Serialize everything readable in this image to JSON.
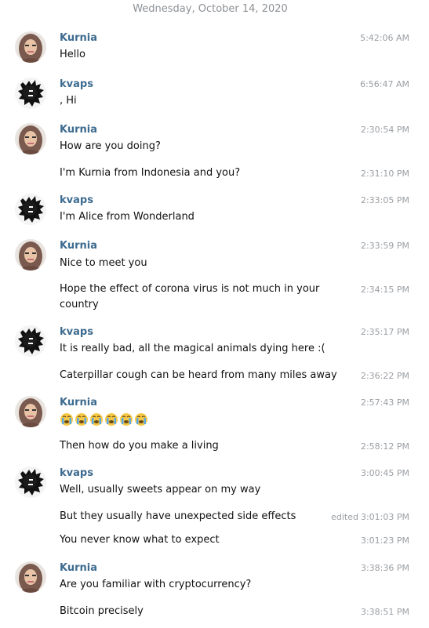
{
  "date_divider": "Wednesday, October 14, 2020",
  "messages": [
    {
      "sender": "Kurnia",
      "text": "Hello",
      "time": "5:42:06 AM"
    },
    {
      "sender": "kvaps",
      "text": ", Hi",
      "time": "6:56:47 AM"
    },
    {
      "sender": "Kurnia",
      "text": "How are you doing?",
      "time": "2:30:54 PM"
    },
    {
      "text": "I'm Kurnia from Indonesia and you?",
      "time": "2:31:10 PM"
    },
    {
      "sender": "kvaps",
      "text": "I'm Alice from Wonderland",
      "time": "2:33:05 PM"
    },
    {
      "sender": "Kurnia",
      "text": "Nice to meet you",
      "time": "2:33:59 PM"
    },
    {
      "text": "Hope the effect of corona virus is not much in your country",
      "time": "2:34:15 PM"
    },
    {
      "sender": "kvaps",
      "text": "It is really bad, all the magical animals dying here :(",
      "time": "2:35:17 PM"
    },
    {
      "text": "Caterpillar cough can be heard from many miles away",
      "time": "2:36:22 PM"
    },
    {
      "sender": "Kurnia",
      "emoji": "loudly-crying-face",
      "emoji_count": 6,
      "time": "2:57:43 PM"
    },
    {
      "text": "Then how do you make a living",
      "time": "2:58:12 PM"
    },
    {
      "sender": "kvaps",
      "text": "Well, usually sweets appear on my way",
      "time": "3:00:45 PM"
    },
    {
      "text": "But they usually have unexpected side effects",
      "edited": "edited",
      "time": "3:01:03 PM"
    },
    {
      "text": "You never know what to expect",
      "time": "3:01:23 PM"
    },
    {
      "sender": "Kurnia",
      "text": "Are you familiar with cryptocurrency?",
      "time": "3:38:36 PM"
    },
    {
      "text": "Bitcoin precisely",
      "time": "3:38:51 PM"
    }
  ]
}
